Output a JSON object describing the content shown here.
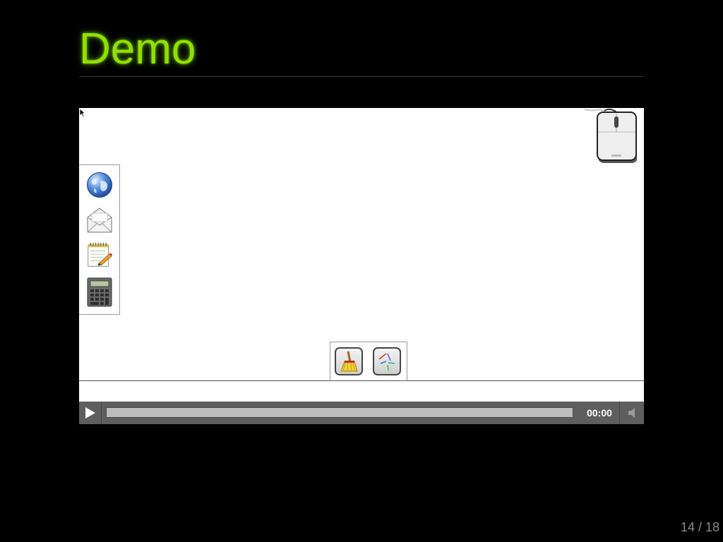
{
  "slide": {
    "title": "Demo",
    "page_counter": "14 / 18"
  },
  "demo_video": {
    "dock_icons": [
      "globe-icon",
      "mail-icon",
      "notepad-icon",
      "calculator-icon"
    ],
    "tool_icons": [
      "broom-icon",
      "strokes-icon"
    ],
    "mouse_graphic_icon": "computer-mouse-icon"
  },
  "player": {
    "play_icon": "play-icon",
    "time": "00:00",
    "progress": 0.0,
    "volume_icon": "speaker-muted-icon"
  },
  "colors": {
    "title": "#8fe000",
    "background": "#000000",
    "controls_bar": "#5e5e5e"
  }
}
